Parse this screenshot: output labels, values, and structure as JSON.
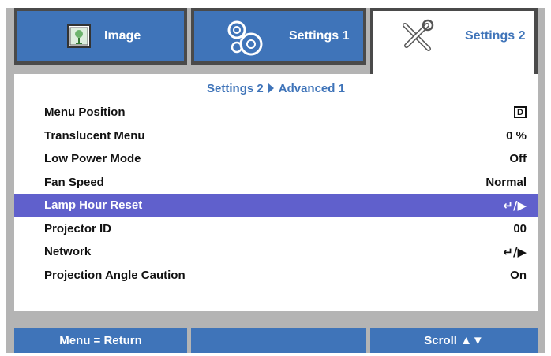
{
  "tabs": [
    {
      "label": "Image",
      "icon": "image-icon",
      "active": false
    },
    {
      "label": "Settings 1",
      "icon": "gears-icon",
      "active": false
    },
    {
      "label": "Settings 2",
      "icon": "tools-icon",
      "active": true
    }
  ],
  "breadcrumb": {
    "parent": "Settings 2",
    "child": "Advanced 1"
  },
  "menu": [
    {
      "label": "Menu Position",
      "value": "D",
      "value_type": "position-icon"
    },
    {
      "label": "Translucent Menu",
      "value": "0 %"
    },
    {
      "label": "Low Power Mode",
      "value": "Off"
    },
    {
      "label": "Fan Speed",
      "value": "Normal"
    },
    {
      "label": "Lamp Hour Reset",
      "value": "↵/▶",
      "selected": true
    },
    {
      "label": "Projector ID",
      "value": "00"
    },
    {
      "label": "Network",
      "value": "↵/▶"
    },
    {
      "label": "Projection Angle Caution",
      "value": "On"
    }
  ],
  "footer": {
    "left": "Menu = Return",
    "middle": "",
    "right": "Scroll ▲▼"
  },
  "colors": {
    "accent": "#3f74b9",
    "selected_row": "#6060cc",
    "frame": "#b4b4b4",
    "tab_border": "#4a4a4a"
  }
}
